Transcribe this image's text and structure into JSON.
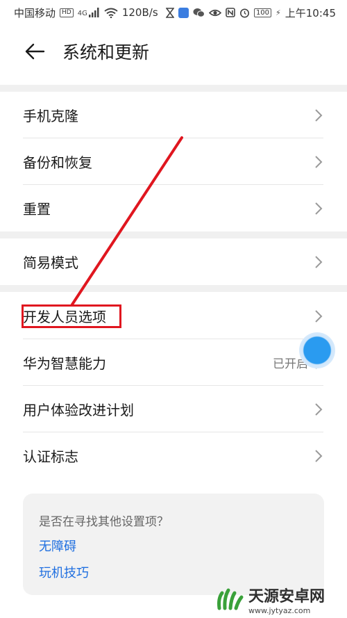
{
  "status_bar": {
    "carrier": "中国移动",
    "hd": "HD",
    "network": "4G",
    "speed": "120B/s",
    "battery": "100",
    "time": "上午10:45"
  },
  "header": {
    "title": "系统和更新"
  },
  "settings": {
    "group1": [
      {
        "label": "手机克隆"
      },
      {
        "label": "备份和恢复"
      },
      {
        "label": "重置"
      }
    ],
    "group2": [
      {
        "label": "简易模式"
      }
    ],
    "group3": [
      {
        "label": "开发人员选项"
      },
      {
        "label": "华为智慧能力",
        "value": "已开启"
      },
      {
        "label": "用户体验改进计划"
      },
      {
        "label": "认证标志"
      }
    ]
  },
  "suggestions": {
    "question": "是否在寻找其他设置项？",
    "links": [
      "无障碍",
      "玩机技巧"
    ]
  },
  "watermark": {
    "name": "天源安卓网",
    "url": "www.jytyaz.com"
  },
  "colors": {
    "accent_link": "#1f6fe0",
    "annotation_red": "#e0161f",
    "float_ball": "#2a9bf0"
  }
}
